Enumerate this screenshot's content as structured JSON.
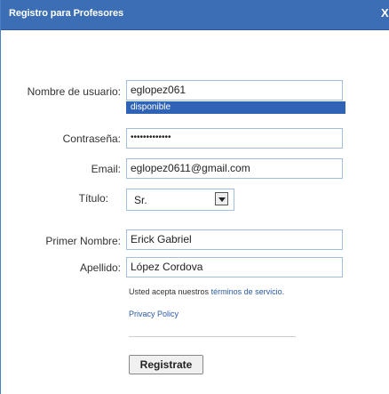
{
  "dialog": {
    "title": "Registro para Profesores",
    "close": "X"
  },
  "form": {
    "username": {
      "label": "Nombre de usuario:",
      "value": "eglopez061",
      "status": "disponible"
    },
    "password": {
      "label": "Contraseña:",
      "value": "•••••••••••••"
    },
    "email": {
      "label": "Email:",
      "value": "eglopez0611@gmail.com"
    },
    "title": {
      "label": "Título:",
      "value": "Sr."
    },
    "first_name": {
      "label": "Primer Nombre:",
      "value": "Erick Gabriel"
    },
    "last_name": {
      "label": "Apellido:",
      "value": "López Cordova"
    }
  },
  "terms": {
    "prefix": "Usted acepta nuestros",
    "link": "términos de servicio.",
    "privacy": "Privacy Policy"
  },
  "submit": {
    "label": "Registrate"
  }
}
